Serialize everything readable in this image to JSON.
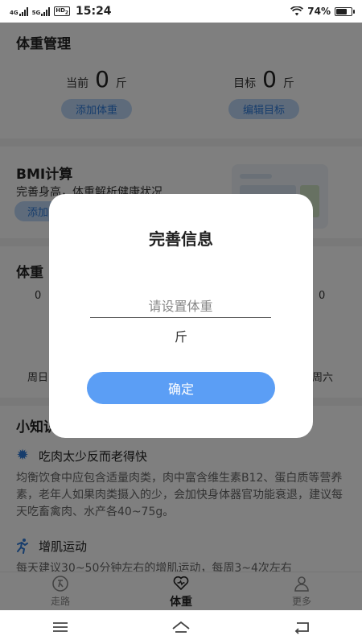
{
  "statusbar": {
    "network_a": "4G",
    "network_b": "5G",
    "hd": "HD",
    "hd_sub": "2",
    "time": "15:24",
    "battery": "74%",
    "battery_level": 0.74
  },
  "weight_manage": {
    "title": "体重管理",
    "current": {
      "label": "当前",
      "value": "0",
      "unit": "斤",
      "button": "添加体重"
    },
    "target": {
      "label": "目标",
      "value": "0",
      "unit": "斤",
      "button": "编辑目标"
    }
  },
  "bmi": {
    "title": "BMI计算",
    "subtitle": "完善身高，体重解析健康状况",
    "button": "添加"
  },
  "chart_section": {
    "title": "体重",
    "left_value": "0",
    "right_value": "0",
    "left_day": "周日",
    "right_day": "周六"
  },
  "tips": {
    "title": "小知识",
    "items": [
      {
        "title": "吃肉太少反而老得快",
        "body": "均衡饮食中应包含适量肉类，肉中富含维生素B12、蛋白质等营养素，老年人如果肉类摄入的少，会加快身体器官功能衰退，建议每天吃畜禽肉、水产各40~75g。"
      },
      {
        "title": "增肌运动",
        "body": "每天建议30~50分钟左右的增肌运动，每周3~4次左右"
      }
    ]
  },
  "tabbar": {
    "items": [
      {
        "label": "走路"
      },
      {
        "label": "体重"
      },
      {
        "label": "更多"
      }
    ]
  },
  "dialog": {
    "title": "完善信息",
    "input_placeholder": "请设置体重",
    "input_value": "",
    "unit": "斤",
    "confirm": "确定"
  }
}
